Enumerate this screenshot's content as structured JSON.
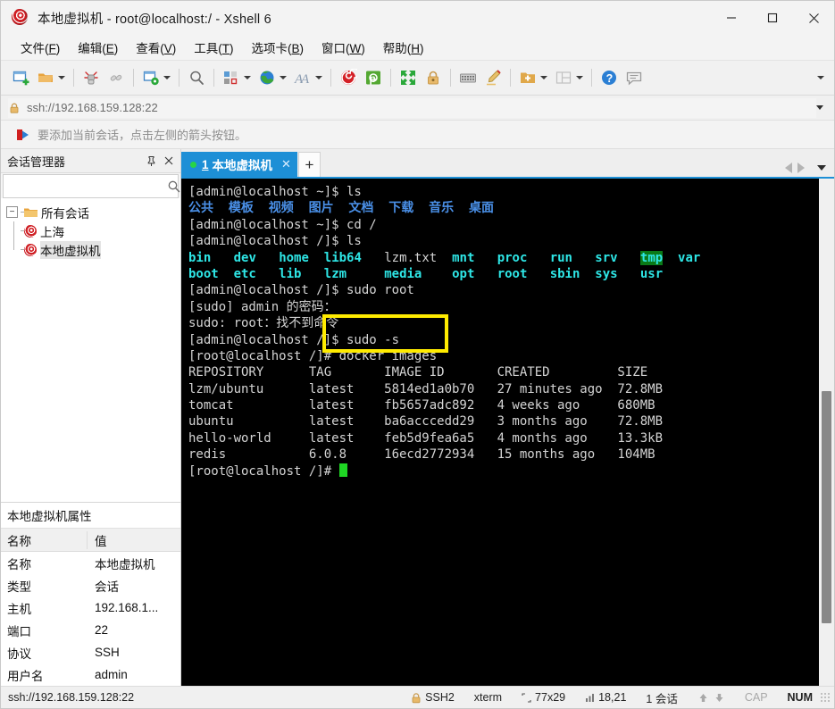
{
  "window": {
    "title": "本地虚拟机 - root@localhost:/ - Xshell 6",
    "app_icon": "xshell-spiral-icon",
    "minimize": "—",
    "maximize": "□",
    "close": "✕"
  },
  "menubar": [
    {
      "label": "文件",
      "accel": "F"
    },
    {
      "label": "编辑",
      "accel": "E"
    },
    {
      "label": "查看",
      "accel": "V"
    },
    {
      "label": "工具",
      "accel": "T"
    },
    {
      "label": "选项卡",
      "accel": "B"
    },
    {
      "label": "窗口",
      "accel": "W"
    },
    {
      "label": "帮助",
      "accel": "H"
    }
  ],
  "toolbar": {
    "buttons": [
      {
        "name": "new-session-icon",
        "dropdown": false
      },
      {
        "name": "open-folder-icon",
        "dropdown": true
      },
      {
        "name": "disconnect-icon",
        "dropdown": false
      },
      {
        "name": "reconnect-icon",
        "dropdown": false
      },
      {
        "name": "session-properties-icon",
        "dropdown": true
      },
      {
        "name": "find-icon",
        "dropdown": false
      },
      {
        "name": "layout-icon",
        "dropdown": true
      },
      {
        "name": "globe-icon",
        "dropdown": true
      },
      {
        "name": "font-icon",
        "dropdown": true
      },
      {
        "name": "xshell-icon",
        "dropdown": false
      },
      {
        "name": "xftp-icon",
        "dropdown": false
      },
      {
        "name": "fullscreen-icon",
        "dropdown": false
      },
      {
        "name": "lock-icon",
        "dropdown": false
      },
      {
        "name": "keyboard-icon",
        "dropdown": false
      },
      {
        "name": "highlight-icon",
        "dropdown": false
      },
      {
        "name": "add-folder-icon",
        "dropdown": true
      },
      {
        "name": "split-view-icon",
        "dropdown": true
      },
      {
        "name": "help-icon",
        "dropdown": false
      },
      {
        "name": "chat-icon",
        "dropdown": false
      }
    ],
    "overflow": "chevron-down-icon"
  },
  "address": {
    "lock_icon": "lock-icon",
    "value": "ssh://192.168.159.128:22",
    "dropdown_icon": "chevron-down-icon"
  },
  "notice": {
    "icon": "red-arrow-icon",
    "text": "要添加当前会话，点击左侧的箭头按钮。"
  },
  "sidebar": {
    "title": "会话管理器",
    "pin_icon": "pin-icon",
    "close_icon": "close-icon",
    "search": {
      "value": "",
      "placeholder": "",
      "icon": "search-icon"
    },
    "tree": {
      "root": {
        "label": "所有会话",
        "icon": "folder-icon",
        "expander": "−"
      },
      "children": [
        {
          "label": "上海",
          "icon": "session-icon",
          "selected": false
        },
        {
          "label": "本地虚拟机",
          "icon": "session-icon",
          "selected": true
        }
      ]
    },
    "properties": {
      "title": "本地虚拟机属性",
      "columns": [
        "名称",
        "值"
      ],
      "rows": [
        {
          "name": "名称",
          "value": "本地虚拟机"
        },
        {
          "name": "类型",
          "value": "会话"
        },
        {
          "name": "主机",
          "value": "192.168.1..."
        },
        {
          "name": "端口",
          "value": "22"
        },
        {
          "name": "协议",
          "value": "SSH"
        },
        {
          "name": "用户名",
          "value": "admin"
        }
      ]
    }
  },
  "tabbar": {
    "tabs": [
      {
        "number": "1",
        "label": "本地虚拟机",
        "status": "connected",
        "close_icon": "close-icon",
        "active": true
      }
    ],
    "new_tab_label": "+",
    "nav_prev_icon": "triangle-left-icon",
    "nav_next_icon": "triangle-right-icon",
    "tab_menu_icon": "chevron-down-icon"
  },
  "terminal": {
    "highlight_box_color": "#ffeb00",
    "cursor_color": "#1fd624",
    "lines": [
      [
        {
          "t": "[admin@localhost ~]$ ls",
          "c": "white"
        }
      ],
      [
        {
          "t": "公共  模板  视频  图片  文档  下载  音乐  桌面",
          "c": "dirblue"
        }
      ],
      [
        {
          "t": "[admin@localhost ~]$ cd /",
          "c": "white"
        }
      ],
      [
        {
          "t": "[admin@localhost /]$ ls",
          "c": "white"
        }
      ],
      [
        {
          "t": "bin",
          "c": "cyanb"
        },
        {
          "t": "   ",
          "c": "white"
        },
        {
          "t": "dev",
          "c": "cyanb"
        },
        {
          "t": "   ",
          "c": "white"
        },
        {
          "t": "home",
          "c": "cyanb"
        },
        {
          "t": "  ",
          "c": "white"
        },
        {
          "t": "lib64",
          "c": "cyanb"
        },
        {
          "t": "   ",
          "c": "white"
        },
        {
          "t": "lzm.txt",
          "c": "white"
        },
        {
          "t": "  ",
          "c": "white"
        },
        {
          "t": "mnt",
          "c": "cyanb"
        },
        {
          "t": "   ",
          "c": "white"
        },
        {
          "t": "proc",
          "c": "cyanb"
        },
        {
          "t": "   ",
          "c": "white"
        },
        {
          "t": "run",
          "c": "cyanb"
        },
        {
          "t": "   ",
          "c": "white"
        },
        {
          "t": "srv",
          "c": "cyanb"
        },
        {
          "t": "   ",
          "c": "white"
        },
        {
          "t": "tmp",
          "c": "tmp"
        },
        {
          "t": "  ",
          "c": "white"
        },
        {
          "t": "var",
          "c": "cyanb"
        }
      ],
      [
        {
          "t": "boot",
          "c": "cyanb"
        },
        {
          "t": "  ",
          "c": "white"
        },
        {
          "t": "etc",
          "c": "cyanb"
        },
        {
          "t": "   ",
          "c": "white"
        },
        {
          "t": "lib",
          "c": "cyanb"
        },
        {
          "t": "   ",
          "c": "white"
        },
        {
          "t": "lzm",
          "c": "cyanb"
        },
        {
          "t": "     ",
          "c": "white"
        },
        {
          "t": "media",
          "c": "cyanb"
        },
        {
          "t": "    ",
          "c": "white"
        },
        {
          "t": "opt",
          "c": "cyanb"
        },
        {
          "t": "   ",
          "c": "white"
        },
        {
          "t": "root",
          "c": "cyanb"
        },
        {
          "t": "   ",
          "c": "white"
        },
        {
          "t": "sbin",
          "c": "cyanb"
        },
        {
          "t": "  ",
          "c": "white"
        },
        {
          "t": "sys",
          "c": "cyanb"
        },
        {
          "t": "   ",
          "c": "white"
        },
        {
          "t": "usr",
          "c": "cyanb"
        }
      ],
      [
        {
          "t": "[admin@localhost /]$ sudo root",
          "c": "white"
        }
      ],
      [
        {
          "t": "[sudo] admin 的密码：",
          "c": "white"
        }
      ],
      [
        {
          "t": "sudo: root：找不到命令",
          "c": "white"
        }
      ],
      [
        {
          "t": "[admin@localhost /]$ sudo -s",
          "c": "white"
        }
      ],
      [
        {
          "t": "[root@localhost /]# docker images",
          "c": "white"
        }
      ],
      [
        {
          "t": "REPOSITORY      TAG       IMAGE ID       CREATED         SIZE",
          "c": "white"
        }
      ],
      [
        {
          "t": "lzm/ubuntu      latest    5814ed1a0b70   27 minutes ago  72.8MB",
          "c": "white"
        }
      ],
      [
        {
          "t": "tomcat          latest    fb5657adc892   4 weeks ago     680MB",
          "c": "white"
        }
      ],
      [
        {
          "t": "ubuntu          latest    ba6acccedd29   3 months ago    72.8MB",
          "c": "white"
        }
      ],
      [
        {
          "t": "hello-world     latest    feb5d9fea6a5   4 months ago    13.3kB",
          "c": "white"
        }
      ],
      [
        {
          "t": "redis           6.0.8     16ecd2772934   15 months ago   104MB",
          "c": "white"
        }
      ],
      [
        {
          "t": "[root@localhost /]# ",
          "c": "white",
          "cursor": true
        }
      ]
    ],
    "docker_images_table": {
      "columns": [
        "REPOSITORY",
        "TAG",
        "IMAGE ID",
        "CREATED",
        "SIZE"
      ],
      "rows": [
        [
          "lzm/ubuntu",
          "latest",
          "5814ed1a0b70",
          "27 minutes ago",
          "72.8MB"
        ],
        [
          "tomcat",
          "latest",
          "fb5657adc892",
          "4 weeks ago",
          "680MB"
        ],
        [
          "ubuntu",
          "latest",
          "ba6acccedd29",
          "3 months ago",
          "72.8MB"
        ],
        [
          "hello-world",
          "latest",
          "feb5d9fea6a5",
          "4 months ago",
          "13.3kB"
        ],
        [
          "redis",
          "6.0.8",
          "16ecd2772934",
          "15 months ago",
          "104MB"
        ]
      ]
    },
    "highlighted_command": "]$ sudo -s"
  },
  "statusbar": {
    "url": "ssh://192.168.159.128:22",
    "lock_icon": "lock-icon",
    "protocol": "SSH2",
    "term_type": "xterm",
    "size_icon": "resize-icon",
    "size": "77x29",
    "pos_icon": "cursor-pos-icon",
    "position": "18,21",
    "sessions": "1 会话",
    "up_icon": "arrow-up-icon",
    "down_icon": "arrow-down-icon",
    "caps": "CAP",
    "num": "NUM"
  }
}
